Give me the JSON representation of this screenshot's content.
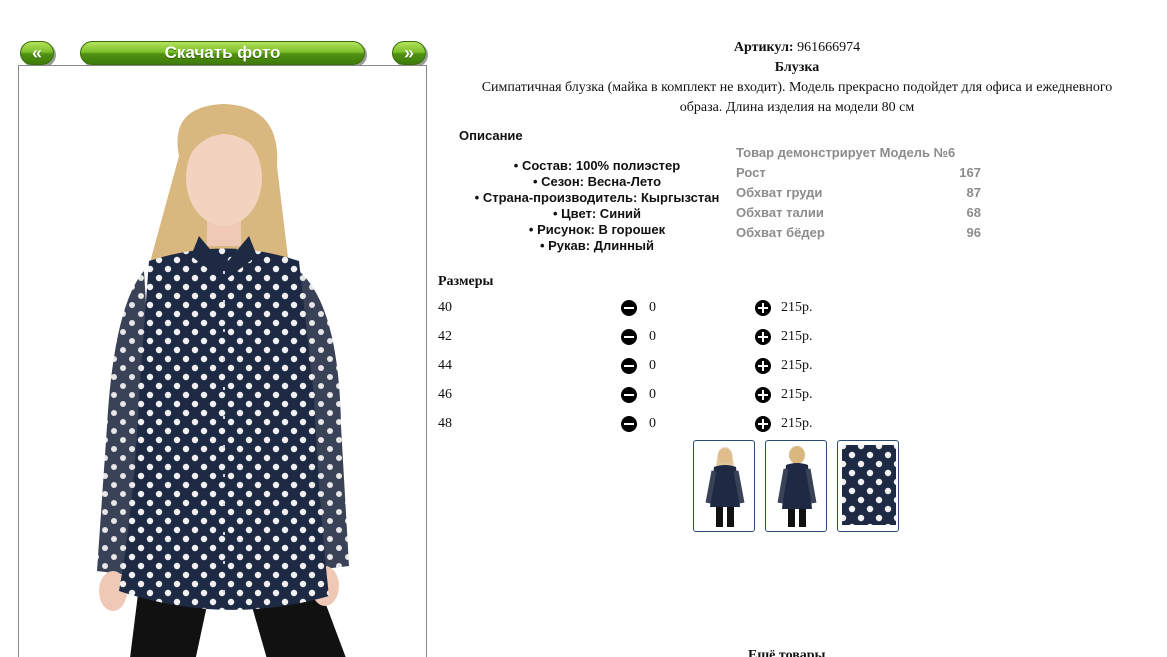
{
  "nav": {
    "prev_label": "«",
    "download_label": "Скачать фото",
    "next_label": "»"
  },
  "product": {
    "article_label": "Артикул:",
    "article_value": "961666974",
    "name": "Блузка",
    "description_line1": "Симпатичная блузка (майка в комплект не входит). Модель прекрасно подойдет для офиса и ежедневного",
    "description_line2": "образа. Длина изделия на модели 80 см"
  },
  "details": {
    "title": "Описание",
    "items": [
      "Состав: 100% полиэстер",
      "Сезон: Весна-Лето",
      "Страна-производитель: Кыргызстан",
      "Цвет: Синий",
      "Рисунок: В горошек",
      "Рукав: Длинный"
    ]
  },
  "model": {
    "title": "Товар демонстрирует Модель №6",
    "rows": [
      {
        "label": "Рост",
        "value": "167"
      },
      {
        "label": "Обхват груди",
        "value": "87"
      },
      {
        "label": "Обхват талии",
        "value": "68"
      },
      {
        "label": "Обхват бёдер",
        "value": "96"
      }
    ]
  },
  "sizes": {
    "title": "Размеры",
    "rows": [
      {
        "size": "40",
        "qty": "0",
        "price": "215р."
      },
      {
        "size": "42",
        "qty": "0",
        "price": "215р."
      },
      {
        "size": "44",
        "qty": "0",
        "price": "215р."
      },
      {
        "size": "46",
        "qty": "0",
        "price": "215р."
      },
      {
        "size": "48",
        "qty": "0",
        "price": "215р."
      }
    ]
  },
  "more_label": "Ещё товары",
  "colors": {
    "button_green": "#5fa51c",
    "blouse_navy": "#1e2a44",
    "frame_blue": "#2b4a7a",
    "model_gray": "#8c8c8c"
  }
}
